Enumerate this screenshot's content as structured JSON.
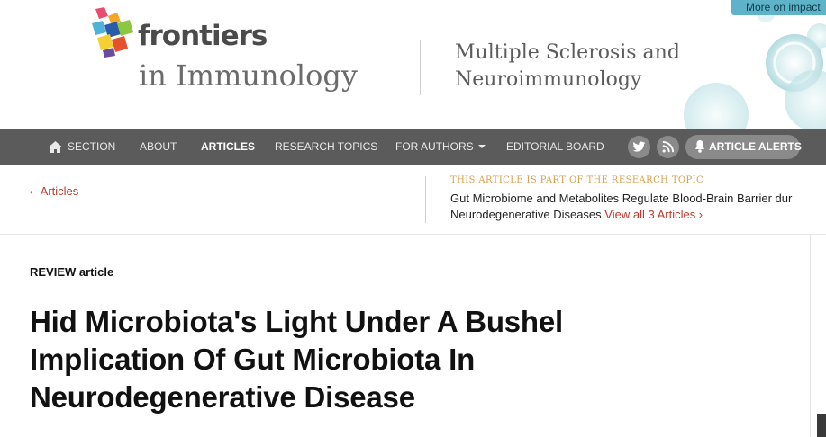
{
  "header": {
    "brand": "frontiers",
    "journal": "in Immunology",
    "section_line1": "Multiple Sclerosis and",
    "section_line2": "Neuroimmunology",
    "impact_button": "More on impact"
  },
  "nav": {
    "items": [
      {
        "label": "SECTION"
      },
      {
        "label": "ABOUT"
      },
      {
        "label": "ARTICLES"
      },
      {
        "label": "RESEARCH TOPICS"
      },
      {
        "label": "FOR AUTHORS"
      },
      {
        "label": "EDITORIAL BOARD"
      }
    ],
    "icons": [
      "twitter-icon",
      "rss-icon",
      "bell-icon",
      "home-icon"
    ],
    "alerts_label": "ARTICLE ALERTS"
  },
  "subbar": {
    "back_label": "Articles",
    "topic_kicker": "THIS ARTICLE IS PART OF THE RESEARCH TOPIC",
    "topic_line1": "Gut Microbiome and Metabolites Regulate Blood-Brain Barrier dur",
    "topic_line2": "Neurodegenerative Diseases",
    "view_all": "View all 3 Articles ›"
  },
  "article": {
    "type": "REVIEW article",
    "title_line1": "Hid Microbiota's Light Under A Bushel",
    "title_line2": "Implication Of Gut Microbiota In",
    "title_line3": "Neurodegenerative Disease"
  },
  "colors": {
    "nav_bg": "#5b5b5b",
    "link_red": "#c0392b",
    "kicker_gold": "#d6a050",
    "impact_teal": "#5eb3c9"
  }
}
